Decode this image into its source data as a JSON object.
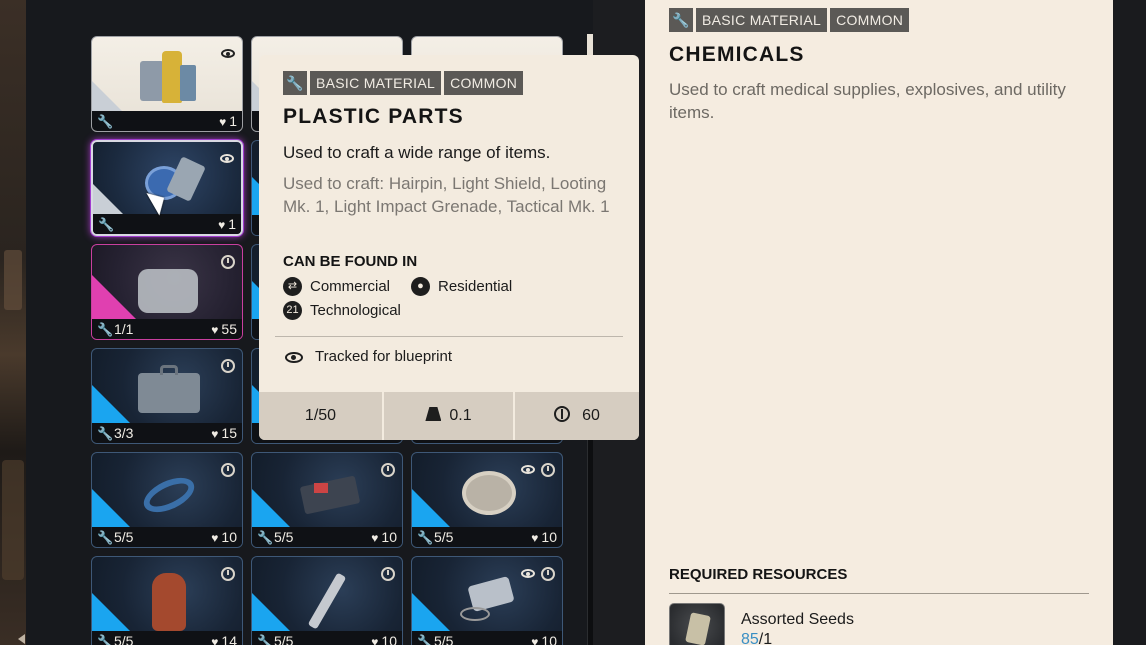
{
  "inventory": {
    "cards": [
      {
        "id": "r1c1",
        "count": "",
        "resource": "1",
        "top_icons": [
          "eye-icon"
        ],
        "style": "light",
        "thumb": "jugs"
      },
      {
        "id": "r2c1",
        "count": "",
        "resource": "1",
        "top_icons": [
          "eye-icon"
        ],
        "style": "light-sel",
        "thumb": "plastic"
      },
      {
        "id": "r3c1",
        "count": "1/1",
        "resource": "55",
        "top_icons": [
          "clock-icon"
        ],
        "style": "pink",
        "thumb": "chems"
      },
      {
        "id": "r4c1",
        "count": "3/3",
        "resource": "15",
        "top_icons": [
          "clock-icon"
        ],
        "style": "blue",
        "thumb": "kit"
      },
      {
        "id": "r5c1",
        "count": "5/5",
        "resource": "10",
        "top_icons": [
          "clock-icon"
        ],
        "style": "blue",
        "thumb": "rope"
      },
      {
        "id": "r5c2",
        "count": "5/5",
        "resource": "10",
        "top_icons": [
          "clock-icon"
        ],
        "style": "blue",
        "thumb": "board"
      },
      {
        "id": "r5c3",
        "count": "5/5",
        "resource": "10",
        "top_icons": [
          "eye-icon",
          "clock-icon"
        ],
        "style": "blue",
        "thumb": "fan"
      },
      {
        "id": "r6c1",
        "count": "5/5",
        "resource": "14",
        "top_icons": [
          "clock-icon"
        ],
        "style": "blue",
        "thumb": "tank"
      },
      {
        "id": "r6c2",
        "count": "5/5",
        "resource": "10",
        "top_icons": [
          "clock-icon"
        ],
        "style": "blue",
        "thumb": "syringe"
      },
      {
        "id": "r6c3",
        "count": "5/5",
        "resource": "10",
        "top_icons": [
          "eye-icon",
          "clock-icon"
        ],
        "style": "blue",
        "thumb": "motor"
      }
    ]
  },
  "tooltip": {
    "tag_category": "BASIC MATERIAL",
    "tag_rarity": "COMMON",
    "title": "PLASTIC PARTS",
    "description": "Used to craft a wide range of items.",
    "craft_text": "Used to craft: Hairpin, Light Shield, Looting Mk. 1, Light Impact Grenade, Tactical Mk. 1",
    "found_heading": "CAN BE FOUND IN",
    "locations": [
      {
        "label": "Commercial",
        "icon": "commercial-icon",
        "glyph": "⇄"
      },
      {
        "label": "Residential",
        "icon": "residential-icon",
        "glyph": "●"
      },
      {
        "label": "Technological",
        "icon": "technological-icon",
        "glyph": "21"
      }
    ],
    "tracked_text": "Tracked for blueprint",
    "stats": {
      "stack": "1/50",
      "weight": "0.1",
      "value": "60"
    }
  },
  "panel": {
    "tag_category": "BASIC MATERIAL",
    "tag_rarity": "COMMON",
    "title": "CHEMICALS",
    "description": "Used to craft medical supplies, explosives, and utility items.",
    "required_heading": "REQUIRED RESOURCES",
    "resource": {
      "name": "Assorted Seeds",
      "have": "85",
      "need": "/1"
    }
  },
  "colors": {
    "accent_blue": "#1aa5f0",
    "accent_pink": "#e040b0",
    "tooltip_bg": "#f3ebdf",
    "have_blue": "#3a8fc4"
  }
}
